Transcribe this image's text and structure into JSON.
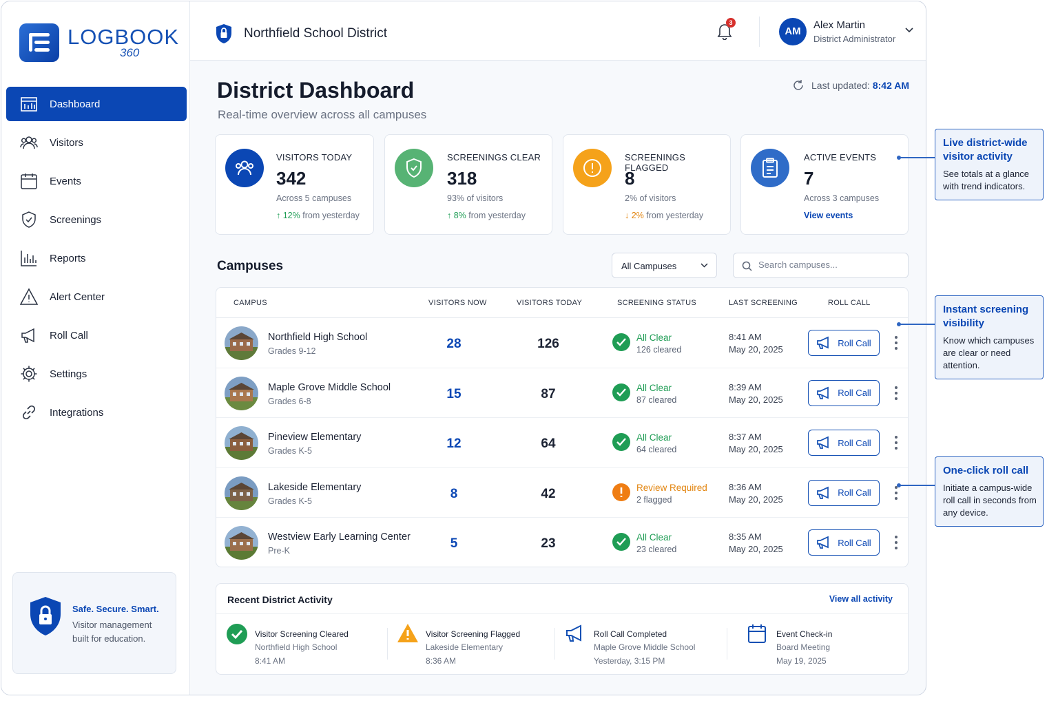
{
  "brand": {
    "name": "LOGBOOK",
    "sub": "360"
  },
  "nav": [
    {
      "label": "Dashboard",
      "icon": "dashboard-icon"
    },
    {
      "label": "Visitors",
      "icon": "users-icon"
    },
    {
      "label": "Events",
      "icon": "calendar-icon"
    },
    {
      "label": "Screenings",
      "icon": "shield-icon"
    },
    {
      "label": "Reports",
      "icon": "bar-chart-icon"
    },
    {
      "label": "Alert Center",
      "icon": "warning-icon"
    },
    {
      "label": "Roll Call",
      "icon": "megaphone-icon"
    },
    {
      "label": "Settings",
      "icon": "gear-icon"
    },
    {
      "label": "Integrations",
      "icon": "link-icon"
    }
  ],
  "promo": {
    "title": "Safe. Secure. Smart.",
    "body": "Visitor management built for education."
  },
  "header": {
    "district": "Northfield School District",
    "notifications": "3",
    "user": {
      "initials": "AM",
      "name": "Alex Martin",
      "role": "District Administrator"
    }
  },
  "page": {
    "title": "District Dashboard",
    "subtitle": "Real-time overview across all campuses",
    "updated_label": "Last updated:",
    "updated_time": "8:42 AM"
  },
  "stats": [
    {
      "label": "VISITORS TODAY",
      "value": "342",
      "note": "Across 5 campuses",
      "trend_value": "12%",
      "trend_text": "from yesterday",
      "direction": "up"
    },
    {
      "label": "SCREENINGS CLEAR",
      "value": "318",
      "note": "93% of visitors",
      "trend_value": "8%",
      "trend_text": "from yesterday",
      "direction": "up"
    },
    {
      "label": "SCREENINGS FLAGGED",
      "value": "8",
      "note": "2% of visitors",
      "trend_value": "2%",
      "trend_text": "from yesterday",
      "direction": "down"
    },
    {
      "label": "ACTIVE EVENTS",
      "value": "7",
      "note": "Across 3 campuses",
      "link": "View events"
    }
  ],
  "campuses_section": {
    "title": "Campuses",
    "filter_value": "All Campuses",
    "search_placeholder": "Search campuses...",
    "columns": [
      "CAMPUS",
      "VISITORS NOW",
      "VISITORS TODAY",
      "SCREENING STATUS",
      "LAST SCREENING",
      "ROLL CALL"
    ],
    "rows": [
      {
        "name": "Northfield High School",
        "grades": "Grades 9-12",
        "now": "28",
        "today": "126",
        "status": "All Clear",
        "status_sub": "126 cleared",
        "state": "clear",
        "time": "8:41 AM",
        "date": "May 20, 2025",
        "action": "Roll Call"
      },
      {
        "name": "Maple Grove Middle School",
        "grades": "Grades 6-8",
        "now": "15",
        "today": "87",
        "status": "All Clear",
        "status_sub": "87 cleared",
        "state": "clear",
        "time": "8:39 AM",
        "date": "May 20, 2025",
        "action": "Roll Call"
      },
      {
        "name": "Pineview Elementary",
        "grades": "Grades K-5",
        "now": "12",
        "today": "64",
        "status": "All Clear",
        "status_sub": "64 cleared",
        "state": "clear",
        "time": "8:37 AM",
        "date": "May 20, 2025",
        "action": "Roll Call"
      },
      {
        "name": "Lakeside Elementary",
        "grades": "Grades K-5",
        "now": "8",
        "today": "42",
        "status": "Review Required",
        "status_sub": "2 flagged",
        "state": "review",
        "time": "8:36 AM",
        "date": "May 20, 2025",
        "action": "Roll Call"
      },
      {
        "name": "Westview Early Learning Center",
        "grades": "Pre-K",
        "now": "5",
        "today": "23",
        "status": "All Clear",
        "status_sub": "23 cleared",
        "state": "clear",
        "time": "8:35 AM",
        "date": "May 20, 2025",
        "action": "Roll Call"
      }
    ]
  },
  "activity": {
    "title": "Recent District Activity",
    "link": "View all activity",
    "items": [
      {
        "title": "Visitor Screening Cleared",
        "sub": "Northfield High School",
        "time": "8:41 AM",
        "icon": "check-circle-icon"
      },
      {
        "title": "Visitor Screening Flagged",
        "sub": "Lakeside Elementary",
        "time": "8:36 AM",
        "icon": "warning-icon"
      },
      {
        "title": "Roll Call Completed",
        "sub": "Maple Grove Middle School",
        "time": "Yesterday, 3:15 PM",
        "icon": "megaphone-icon"
      },
      {
        "title": "Event Check-in",
        "sub": "Board Meeting",
        "time": "May 19, 2025",
        "icon": "calendar-icon"
      }
    ]
  },
  "callouts": [
    {
      "title": "Live district-wide visitor activity",
      "body": "See totals at a glance with trend indicators."
    },
    {
      "title": "Instant screening visibility",
      "body": "Know which campuses are clear or need attention."
    },
    {
      "title": "One-click roll call",
      "body": "Initiate a campus-wide roll call in seconds from any device."
    }
  ],
  "colors": {
    "primary": "#0b47b4",
    "success": "#1f9d55",
    "warning": "#f5a21a",
    "danger": "#d6302c"
  }
}
